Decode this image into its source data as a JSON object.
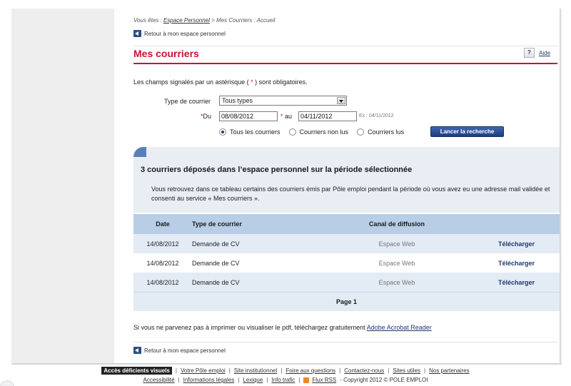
{
  "breadcrumb": {
    "prefix": "Vous êtes :",
    "link": "Espace Personnel",
    "rest": "> Mes Courriers : Accueil"
  },
  "back_link": "Retour à mon espace personnel",
  "back_link_bottom": "Retour à mon espace personnel",
  "page_title": "Mes courriers",
  "help": {
    "icon": "?",
    "label": "Aide"
  },
  "mandatory_note": {
    "before": "Les champs signalés par un astérisque (",
    "star": "*",
    "after": ") sont obligatoires."
  },
  "form": {
    "type_label": "Type de courrier",
    "type_value": "Tous types",
    "star": "*",
    "du_label": "Du",
    "du_value": "08/08/2012",
    "au_label": "au",
    "au_value": "04/11/2012",
    "example": "Ex : 04/11/2012",
    "radios": [
      {
        "label": "Tous les courriers",
        "checked": true
      },
      {
        "label": "Courriers non lus",
        "checked": false
      },
      {
        "label": "Courriers lus",
        "checked": false
      }
    ],
    "search_button": "Lancer la recherche"
  },
  "results": {
    "title": "3 courriers déposés dans l’espace personnel sur la période sélectionnée",
    "text": "Vous retrouvez dans ce tableau certains des courriers émis par Pôle emploi pendant la période où vous avez eu une adresse mail validée et consenti au service « Mes courriers »."
  },
  "table": {
    "headers": {
      "date": "Date",
      "type": "Type de courrier",
      "canal": "Canal de diffusion",
      "download": ""
    },
    "rows": [
      {
        "date": "14/08/2012",
        "type": "Demande de CV",
        "canal": "Espace Web",
        "action": "Télécharger"
      },
      {
        "date": "14/08/2012",
        "type": "Demande de CV",
        "canal": "Espace Web",
        "action": "Télécharger"
      },
      {
        "date": "14/08/2012",
        "type": "Demande de CV",
        "canal": "Espace Web",
        "action": "Télécharger"
      }
    ],
    "pager": "Page 1"
  },
  "pdf_note": {
    "text": "Si vous ne parvenez pas à imprimer ou visualiser le pdf, téléchargez gratuitement",
    "link": "Adobe Acrobat Reader"
  },
  "footer": {
    "row1": [
      "Accès déficients visuels",
      "Votre Pôle emploi",
      "Site institutionnel",
      "Foire aux questions",
      "Contactez-nous",
      "Sites utiles",
      "Nos partenaires"
    ],
    "row2": [
      "Accessibilité",
      "Informations légales",
      "Lexique",
      "Info trafic",
      "Flux RSS"
    ],
    "copyright": "- Copyright 2012 © POLE EMPLOI"
  },
  "colors": {
    "accent_red": "#cc1133",
    "navy": "#1f3a70",
    "header_blue": "#b8cde6",
    "row_alt": "#e3ebf5"
  }
}
